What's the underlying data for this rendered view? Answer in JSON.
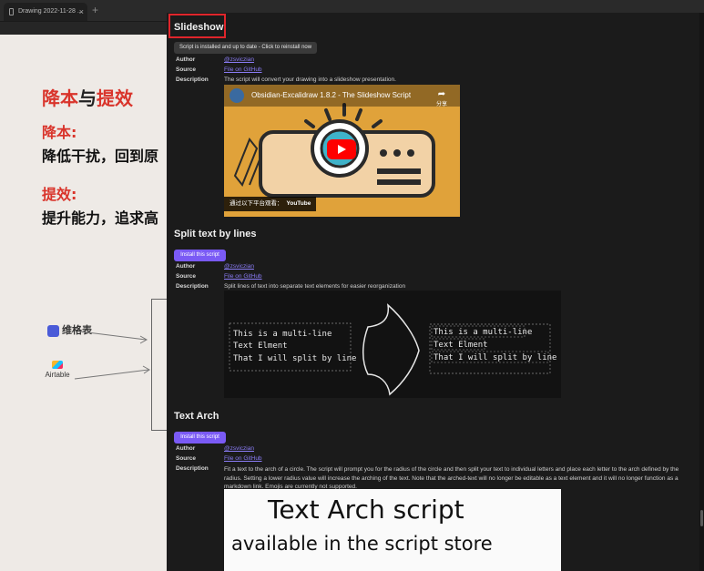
{
  "tabbar": {
    "tab_label": "Drawing 2022-11-28 ...",
    "close_glyph": "×",
    "new_tab_glyph": "+"
  },
  "canvas": {
    "title_a": "降本",
    "title_mid": "与",
    "title_b": "提效",
    "heading1": "降本:",
    "line1": "降低干扰，回到原",
    "heading2": "提效:",
    "line2": "提升能力，追求高",
    "logo1": "维格表",
    "logo2": "Airtable"
  },
  "scripts": [
    {
      "title": "Slideshow",
      "action_label": "Script is installed and up to date - Click to reinstall now",
      "author_key": "Author",
      "author": "@zsviczian",
      "source_key": "Source",
      "source": "File on GitHub",
      "description_key": "Description",
      "description": "The script will convert your drawing into a slideshow presentation.",
      "video": {
        "title": "Obsidian-Excalidraw 1.8.2 - The Slideshow Script",
        "share": "分享",
        "watch_on": "通过以下平台观看：",
        "platform": "YouTube"
      }
    },
    {
      "title": "Split text by lines",
      "action_label": "Install this script",
      "author_key": "Author",
      "author": "@zsviczian",
      "source_key": "Source",
      "source": "File on GitHub",
      "description_key": "Description",
      "description": "Split lines of text into separate text elements for easier reorganization",
      "demo": {
        "left": [
          "This is a multi-line",
          "Text Elment",
          "That I will split by line"
        ],
        "right": [
          "This is a multi-line",
          "Text Elment",
          "That I will split by line"
        ]
      }
    },
    {
      "title": "Text Arch",
      "action_label": "Install this script",
      "author_key": "Author",
      "author": "@zsviczian",
      "source_key": "Source",
      "source": "File on GitHub",
      "description_key": "Description",
      "description": "Fit a text to the arch of a circle. The script will prompt you for the radius of the circle and then split your text to individual letters and place each letter to the arch defined by the radius. Setting a lower radius value will increase the arching of the text. Note that the arched-text will no longer be editable as a text element and it will no longer function as a markdown link. Emojis are currently not supported.",
      "demo": {
        "line1": "Text Arch script",
        "line2": "available in the script store"
      }
    }
  ],
  "colors": {
    "accent": "#7a5af5",
    "highlight": "#e0252b",
    "link": "#8a7cf5"
  }
}
